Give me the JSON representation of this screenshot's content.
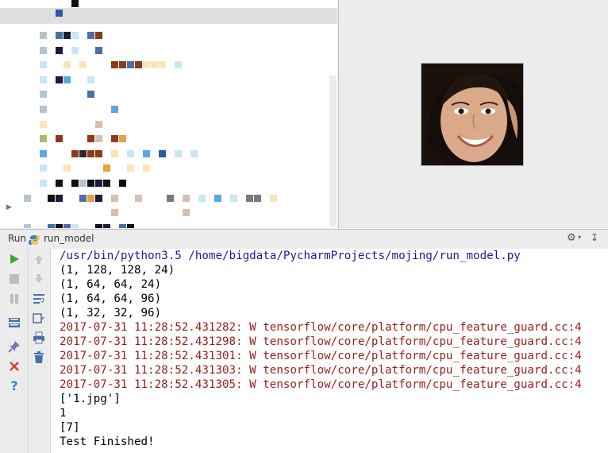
{
  "run_panel": {
    "tab_label": "Run",
    "config_name": "run_model"
  },
  "console": {
    "lines": [
      {
        "text": "/usr/bin/python3.5 /home/bigdata/PycharmProjects/mojing/run_model.py",
        "kind": "command"
      },
      {
        "text": "(1, 128, 128, 24)",
        "kind": "stdout"
      },
      {
        "text": "(1, 64, 64, 24)",
        "kind": "stdout"
      },
      {
        "text": "(1, 64, 64, 96)",
        "kind": "stdout"
      },
      {
        "text": "(1, 32, 32, 96)",
        "kind": "stdout"
      },
      {
        "text": "2017-07-31 11:28:52.431282: W tensorflow/core/platform/cpu_feature_guard.cc:4",
        "kind": "stderr"
      },
      {
        "text": "2017-07-31 11:28:52.431298: W tensorflow/core/platform/cpu_feature_guard.cc:4",
        "kind": "stderr"
      },
      {
        "text": "2017-07-31 11:28:52.431301: W tensorflow/core/platform/cpu_feature_guard.cc:4",
        "kind": "stderr"
      },
      {
        "text": "2017-07-31 11:28:52.431303: W tensorflow/core/platform/cpu_feature_guard.cc:4",
        "kind": "stderr"
      },
      {
        "text": "2017-07-31 11:28:52.431305: W tensorflow/core/platform/cpu_feature_guard.cc:4",
        "kind": "stderr"
      },
      {
        "text": "['1.jpg']",
        "kind": "stdout"
      },
      {
        "text": "1",
        "kind": "stdout"
      },
      {
        "text": "[7]",
        "kind": "stdout"
      },
      {
        "text": "Test Finished!",
        "kind": "stdout"
      }
    ]
  },
  "colors": {
    "command": "#1a1aa6",
    "stdout": "#000000",
    "stderr": "#9b1c1c",
    "run_green": "#3fa33f",
    "close_red": "#d9412e",
    "help_blue": "#3d7ed8"
  },
  "toolbar_icons": {
    "left": [
      "rerun-icon",
      "stop-icon",
      "pause-icon",
      "dump-threads-icon",
      "pin-icon",
      "close-icon",
      "help-icon"
    ],
    "right": [
      "scroll-up-icon",
      "scroll-down-icon",
      "soft-wrap-icon",
      "scroll-to-end-icon",
      "print-icon",
      "clear-all-icon"
    ]
  }
}
